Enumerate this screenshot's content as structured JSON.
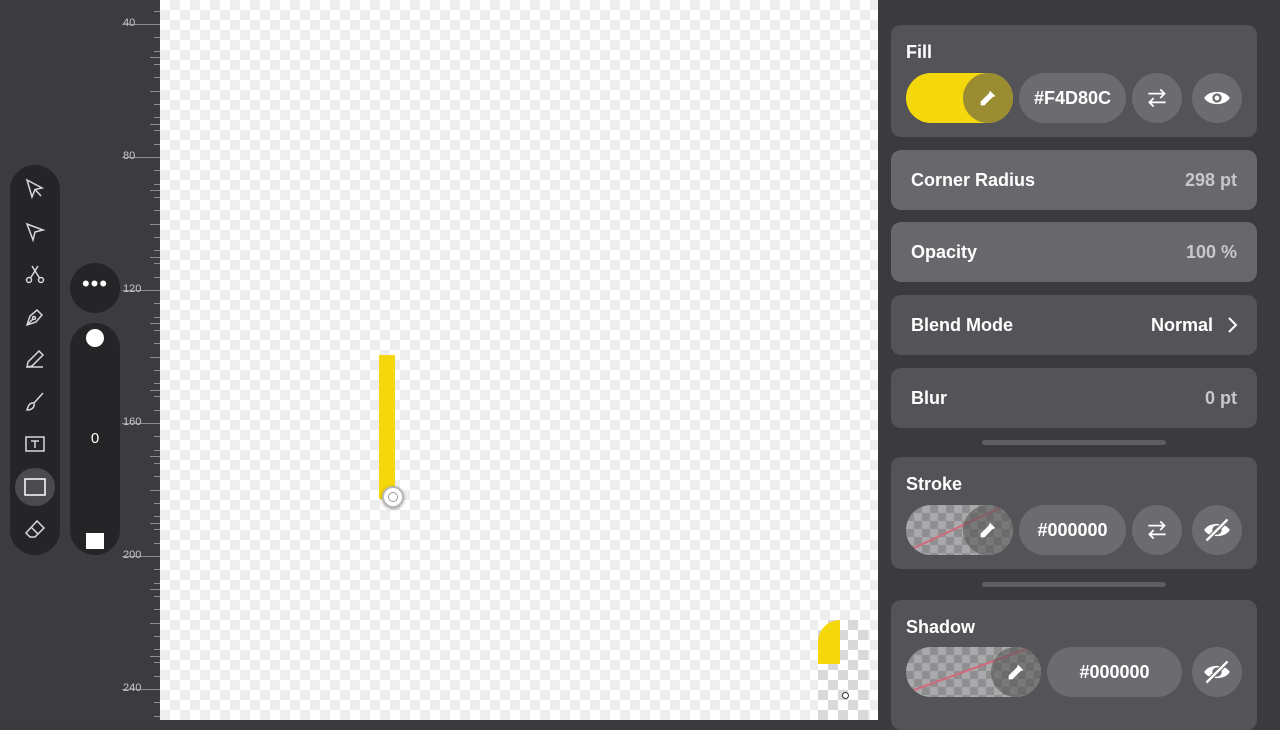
{
  "ruler": {
    "labels": [
      "40",
      "80",
      "120",
      "160",
      "200",
      "240"
    ]
  },
  "toolbar": {
    "tools": [
      {
        "name": "selection-arrow-icon"
      },
      {
        "name": "direct-select-icon"
      },
      {
        "name": "scissors-icon"
      },
      {
        "name": "pen-nib-icon"
      },
      {
        "name": "pencil-icon"
      },
      {
        "name": "brush-icon"
      },
      {
        "name": "text-box-icon"
      },
      {
        "name": "rectangle-icon",
        "active": true
      },
      {
        "name": "eraser-icon"
      }
    ],
    "more_label": "•••",
    "size_value": "0"
  },
  "canvas": {
    "shape_color": "#F4D80C"
  },
  "fill": {
    "title": "Fill",
    "hex": "#F4D80C",
    "color": "#F4D80C"
  },
  "corner_radius": {
    "label": "Corner Radius",
    "value": "298 pt"
  },
  "opacity": {
    "label": "Opacity",
    "value": "100 %"
  },
  "blend_mode": {
    "label": "Blend Mode",
    "value": "Normal"
  },
  "blur": {
    "label": "Blur",
    "value": "0 pt"
  },
  "stroke": {
    "title": "Stroke",
    "hex": "#000000"
  },
  "shadow": {
    "title": "Shadow",
    "hex": "#000000"
  }
}
